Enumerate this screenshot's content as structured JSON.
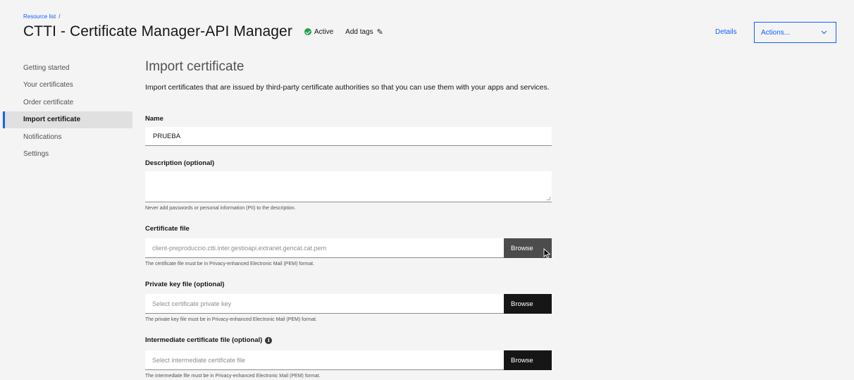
{
  "header": {
    "breadcrumb": {
      "link": "Resource list",
      "separator": "/"
    },
    "title": "CTTI - Certificate Manager-API Manager",
    "status": "Active",
    "add_tags": "Add tags",
    "details": "Details",
    "actions": "Actions..."
  },
  "sidebar": {
    "items": [
      {
        "label": "Getting started"
      },
      {
        "label": "Your certificates"
      },
      {
        "label": "Order certificate"
      },
      {
        "label": "Import certificate"
      },
      {
        "label": "Notifications"
      },
      {
        "label": "Settings"
      }
    ],
    "active": "Import certificate"
  },
  "main": {
    "title": "Import certificate",
    "description": "Import certificates that are issued by third-party certificate authorities so that you can use them with your apps and services.",
    "name": {
      "label": "Name",
      "value": "PRUEBA"
    },
    "desc_field": {
      "label": "Description (optional)",
      "value": "",
      "helper": "Never add passwords or personal information (PII) to the description."
    },
    "cert_file": {
      "label": "Certificate file",
      "value": "client-preproduccio.ctti.inter.gestioapi.extranet.gencat.cat.pem",
      "button": "Browse",
      "helper": "The certificate file must be in Privacy-enhanced Electronic Mail (PEM) format."
    },
    "private_key": {
      "label": "Private key file (optional)",
      "placeholder": "Select certificate private key",
      "button": "Browse",
      "helper": "The private key file must be in Privacy-enhanced Electronic Mail (PEM) format."
    },
    "intermediate": {
      "label": "Intermediate certificate file (optional)",
      "placeholder": "Select intermediate certificate file",
      "button": "Browse",
      "helper": "The intermediate file must be in Privacy-enhanced Electronic Mail (PEM) format."
    }
  },
  "colors": {
    "accent": "#0f62fe",
    "status_active": "#24a148",
    "button_dark": "#161616",
    "background": "#f4f4f4"
  },
  "icons": {
    "status": "checkmark-filled-icon",
    "add_tags": "edit-icon",
    "actions": "chevron-down-icon",
    "intermediate_info": "information-icon"
  }
}
